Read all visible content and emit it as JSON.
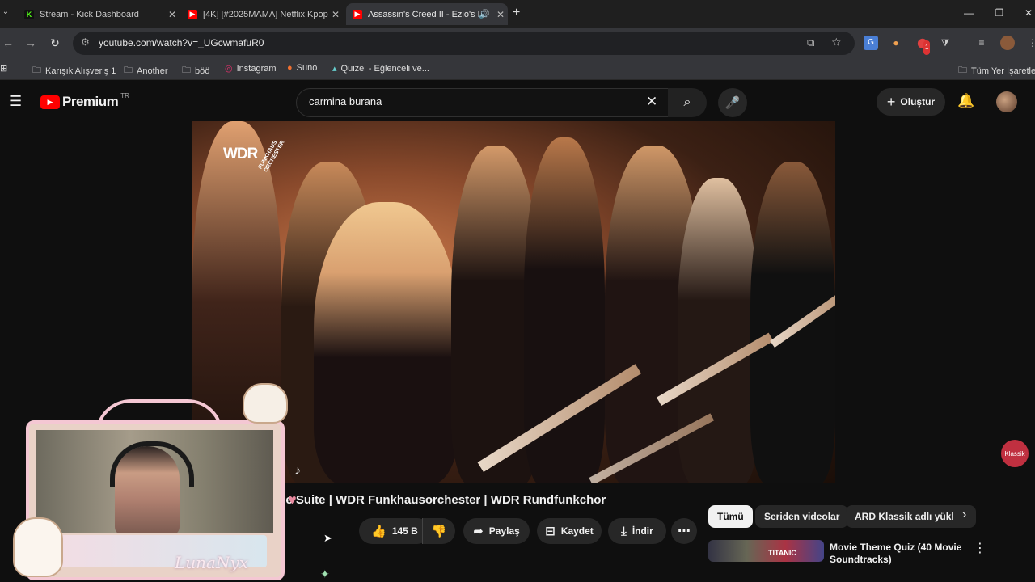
{
  "browser": {
    "tabs": [
      {
        "title": "Stream - Kick Dashboard",
        "favicon": "kick-icon",
        "active": false
      },
      {
        "title": "[4K] [#2025MAMA] Netflix Kpop",
        "favicon": "youtube-icon",
        "active": false
      },
      {
        "title": "Assassin's Creed II - Ezio's F",
        "favicon": "youtube-icon",
        "active": true,
        "audio": true
      }
    ],
    "url": "youtube.com/watch?v=_UGcwmafuR0",
    "bookmarks": [
      "Karışık Alışveriş 1",
      "Another",
      "böö",
      "Instagram",
      "Suno",
      "Quizei - Eğlenceli ve..."
    ],
    "bookmarks_right": "Tüm Yer İşaretleri",
    "extension_badge": "1"
  },
  "youtube": {
    "logo": "Premium",
    "region": "TR",
    "search_query": "carmina burana",
    "create_label": "Oluştur",
    "video": {
      "watermark": "WDR",
      "watermark_sub": "FUNKHAUS ORCHESTER",
      "corner_logo": "Klassik",
      "title": "ce Suite | WDR Funkhausorchester | WDR Rundfunkchor"
    },
    "actions": {
      "likes": "145 B",
      "share": "Paylaş",
      "save": "Kaydet",
      "download": "İndir"
    },
    "chips": [
      "Tümü",
      "Seriden videolar",
      "ARD Klassik adlı yükl"
    ],
    "next_video": {
      "title": "Movie Theme Quiz (40 Movie Soundtracks)",
      "thumb_text": "TITANIC"
    }
  },
  "overlay": {
    "streamer_name": "LunaNyx"
  },
  "colors": {
    "yt_red": "#ff0000",
    "kick_green": "#53fc18",
    "overlay_pink": "#f4c7d3"
  }
}
